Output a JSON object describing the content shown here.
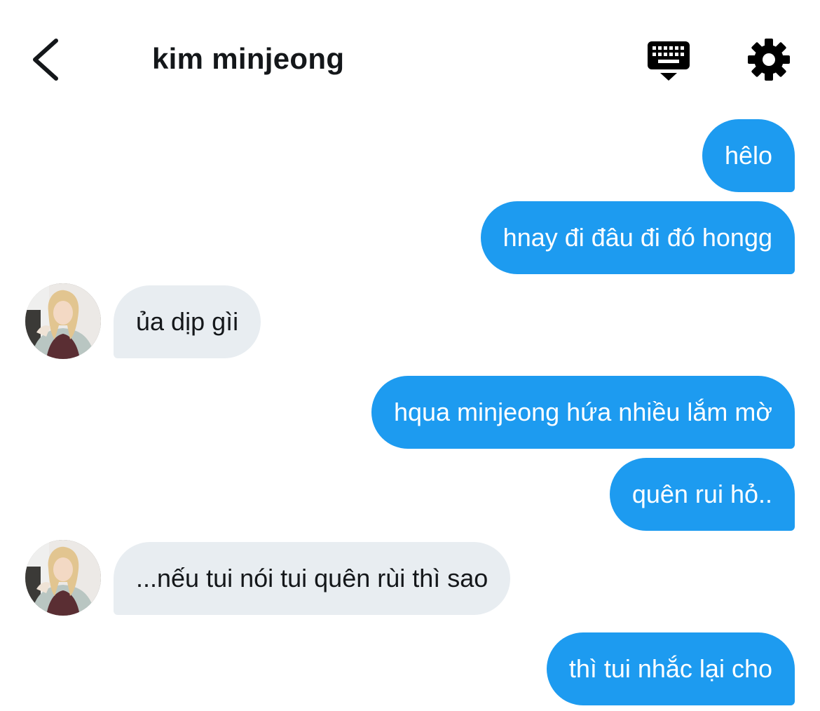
{
  "header": {
    "title": "kim minjeong",
    "back_icon": "chevron-left-icon",
    "keyboard_icon": "keyboard-icon",
    "settings_icon": "gear-icon"
  },
  "colors": {
    "outgoing_bubble": "#1d9bf0",
    "incoming_bubble": "#e8edf1",
    "text_dark": "#14171a"
  },
  "messages": [
    {
      "direction": "out",
      "text": "hêlo"
    },
    {
      "direction": "out",
      "text": "hnay đi đâu đi đó hongg"
    },
    {
      "direction": "in",
      "text": "ủa dịp gìi"
    },
    {
      "direction": "out",
      "text": "hqua minjeong hứa nhiều lắm mờ"
    },
    {
      "direction": "out",
      "text": "quên rui hỏ.."
    },
    {
      "direction": "in",
      "text": "...nếu tui nói tui quên rùi thì sao"
    },
    {
      "direction": "out",
      "text": "thì tui nhắc lại cho"
    }
  ]
}
